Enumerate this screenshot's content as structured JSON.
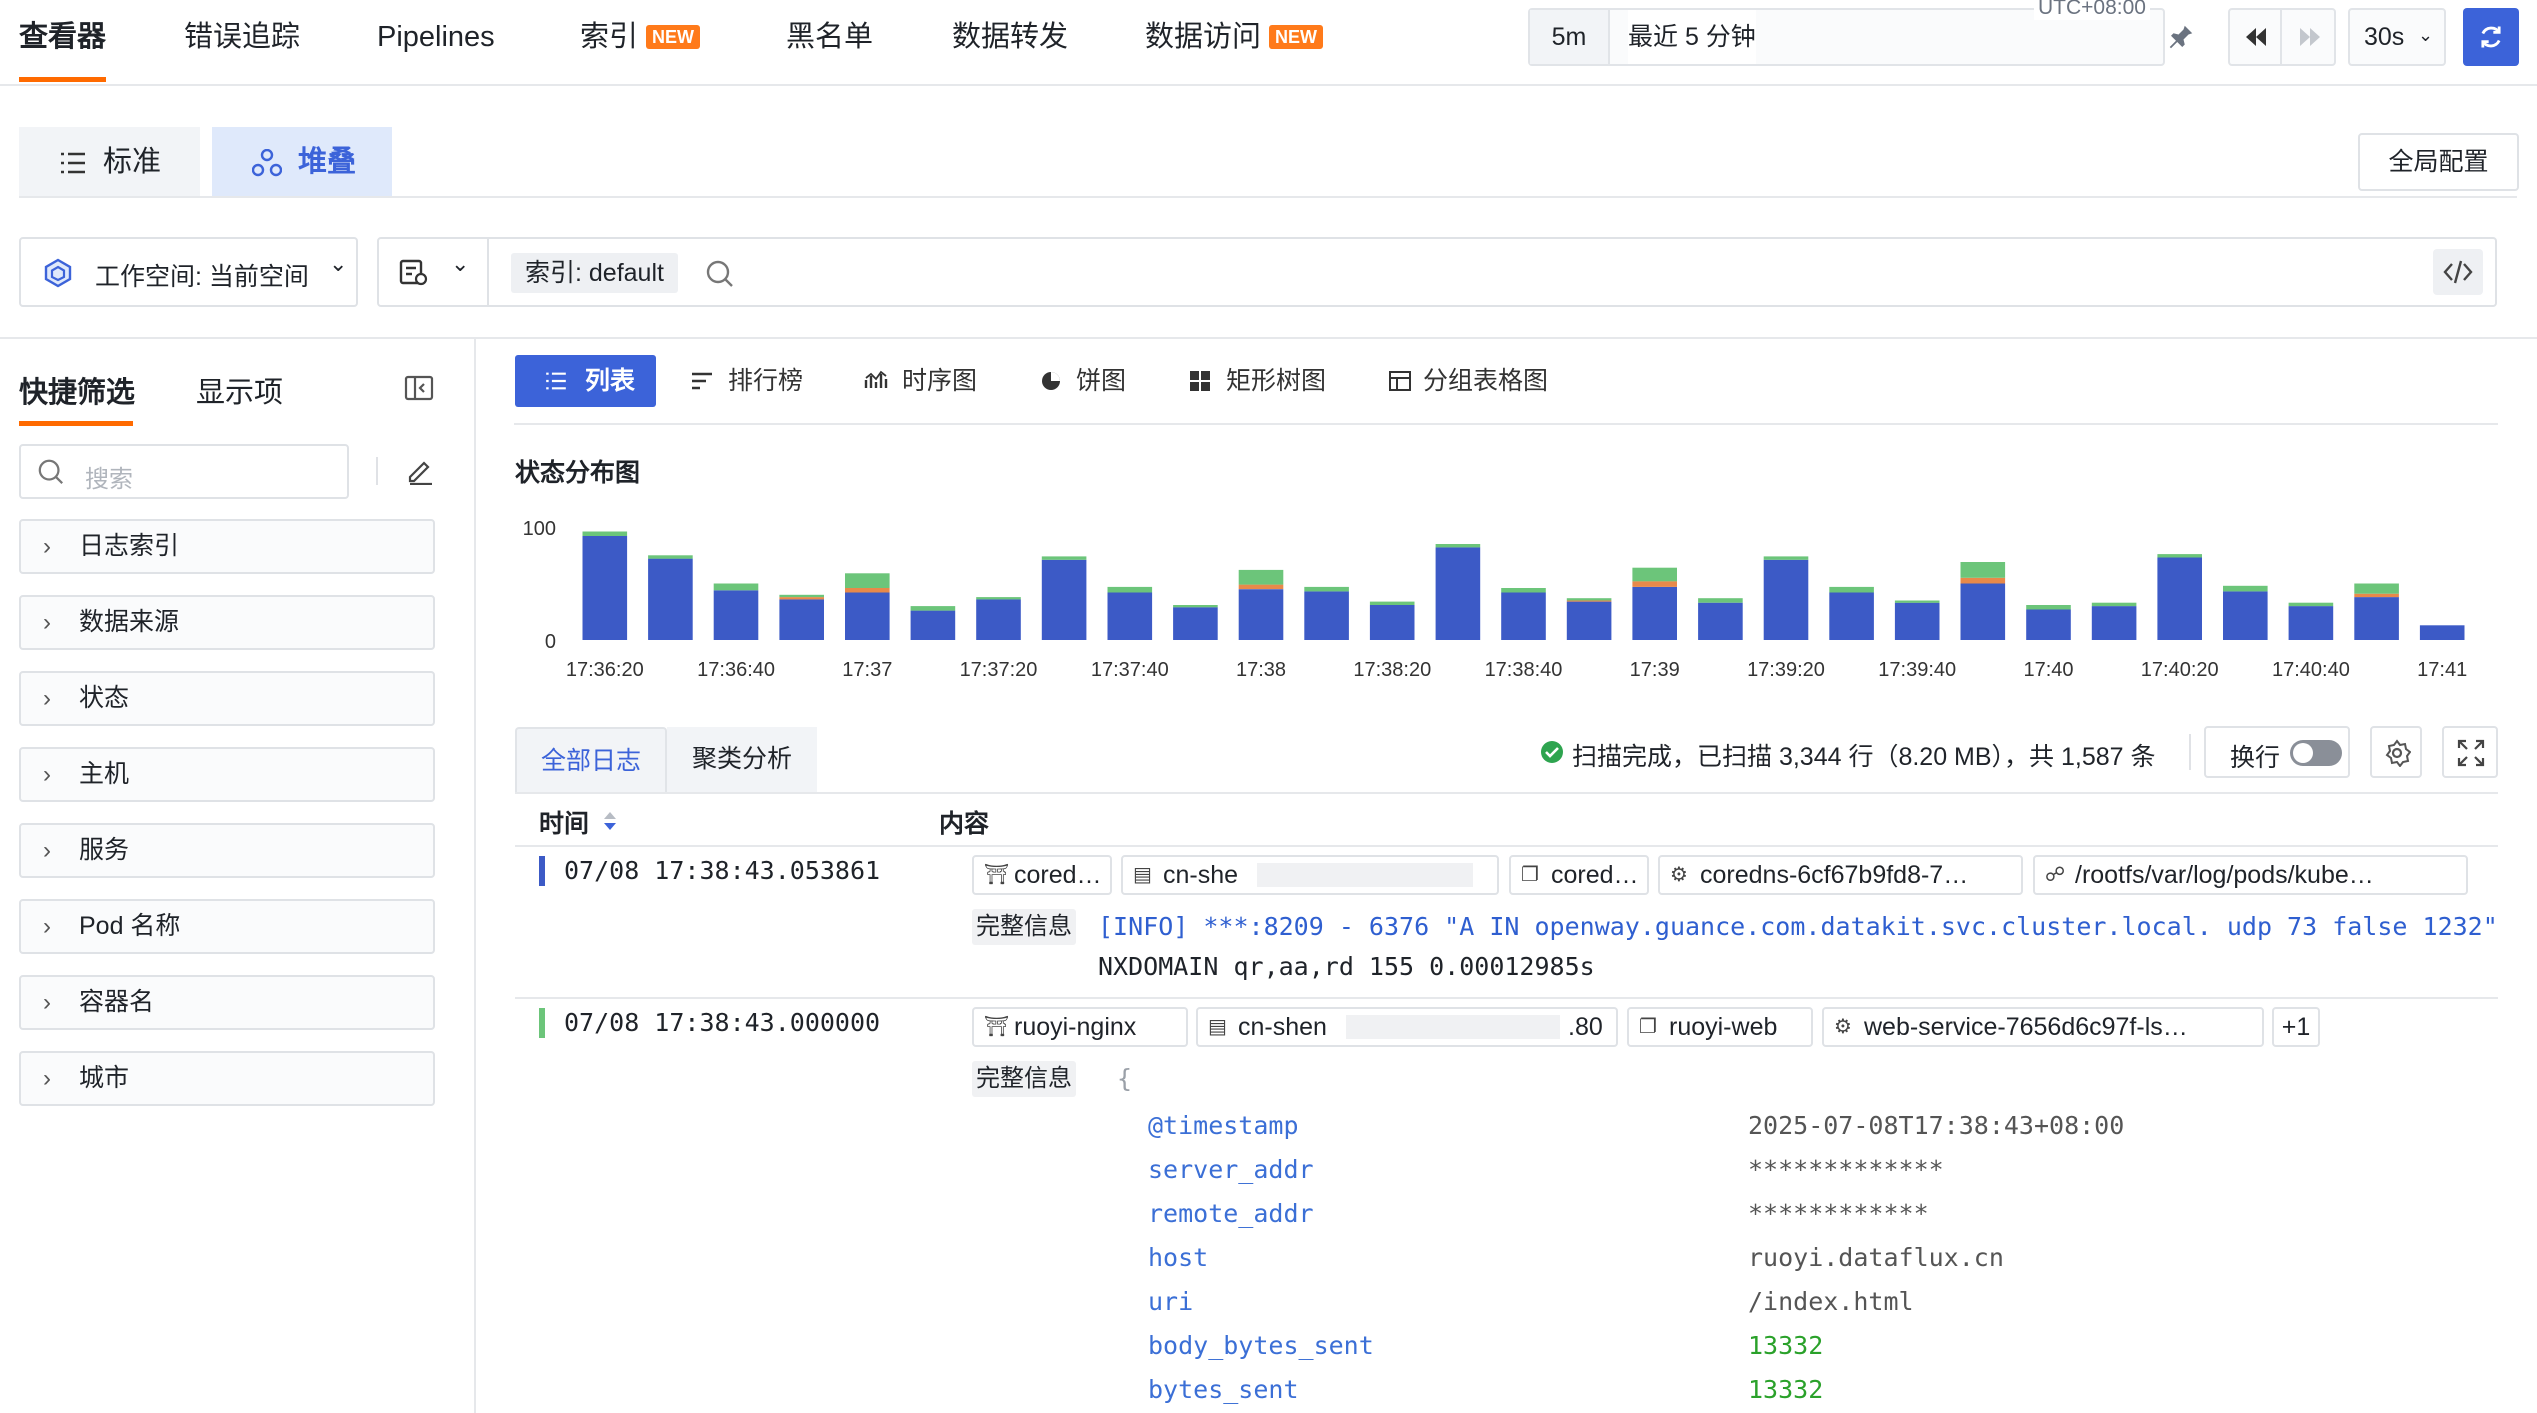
{
  "nav": {
    "tabs": [
      {
        "label": "查看器",
        "new": false
      },
      {
        "label": "错误追踪",
        "new": false
      },
      {
        "label": "Pipelines",
        "new": false
      },
      {
        "label": "索引",
        "new": true
      },
      {
        "label": "黑名单",
        "new": false
      },
      {
        "label": "数据转发",
        "new": false
      },
      {
        "label": "数据访问",
        "new": true
      }
    ],
    "new_badge": "NEW",
    "timezone": "UTC+08:00",
    "quick_range": "5m",
    "range_text": "最近 5 分钟",
    "refresh_interval": "30s"
  },
  "view": {
    "standard": "标准",
    "stacked": "堆叠",
    "global_config": "全局配置"
  },
  "query": {
    "workspace": "工作空间: 当前空间",
    "index_chip": "索引: default"
  },
  "sidebar": {
    "tab_filters": "快捷筛选",
    "tab_display": "显示项",
    "search_placeholder": "搜索",
    "facets": [
      "日志索引",
      "数据来源",
      "状态",
      "主机",
      "服务",
      "Pod 名称",
      "容器名",
      "城市"
    ]
  },
  "main": {
    "tabs": [
      "列表",
      "排行榜",
      "时序图",
      "饼图",
      "矩形树图",
      "分组表格图"
    ],
    "chart_title": "状态分布图"
  },
  "chart_data": {
    "type": "bar",
    "title": "状态分布图",
    "stacked": true,
    "ylim": [
      0,
      100
    ],
    "yticks": [
      "100",
      "0"
    ],
    "xtick_labels": [
      "17:36:20",
      "17:36:40",
      "17:37",
      "17:37:20",
      "17:37:40",
      "17:38",
      "17:38:20",
      "17:38:40",
      "17:39",
      "17:39:20",
      "17:39:40",
      "17:40",
      "17:40:20",
      "17:40:40",
      "17:41"
    ],
    "series": [
      {
        "color": "#3c5ac6",
        "values": [
          92,
          72,
          44,
          36,
          42,
          26,
          36,
          71,
          42,
          29,
          45,
          43,
          31,
          82,
          42,
          34,
          47,
          33,
          71,
          42,
          33,
          50,
          27,
          30,
          73,
          43,
          30,
          38,
          13
        ]
      },
      {
        "color": "#e8894a",
        "values": [
          0,
          0,
          0,
          2,
          4,
          0,
          0,
          0,
          0,
          0,
          4,
          0,
          0,
          0,
          0,
          1,
          5,
          0,
          0,
          0,
          0,
          5,
          0,
          0,
          0,
          0,
          0,
          3,
          0
        ]
      },
      {
        "color": "#6cc57a",
        "values": [
          4,
          3,
          6,
          2,
          13,
          4,
          2,
          3,
          5,
          2,
          13,
          4,
          3,
          3,
          4,
          2,
          12,
          4,
          3,
          5,
          2,
          14,
          4,
          3,
          3,
          5,
          3,
          9,
          0
        ]
      }
    ]
  },
  "logs": {
    "tab_all": "全部日志",
    "tab_cluster": "聚类分析",
    "scan_text": "扫描完成，已扫描 3,344 行（8.20 MB），共 1,587 条",
    "wrap_label": "换行",
    "col_time": "时间",
    "col_content": "内容",
    "full_info": "完整信息",
    "rows": [
      {
        "time": "07/08 17:38:43.053861",
        "status_color": "#3c5ac6",
        "tags": [
          "cored…",
          "cn-she",
          "cored…",
          "coredns-6cf67b9fd8-7…",
          "/rootfs/var/log/pods/kube…"
        ],
        "message_line1": "[INFO] ***:8209 - 6376 \"A IN openway.guance.com.datakit.svc.cluster.local. udp 73 false 1232\"",
        "message_line2": "NXDOMAIN qr,aa,rd 155 0.00012985s"
      },
      {
        "time": "07/08 17:38:43.000000",
        "status_color": "#6cc57a",
        "tags": [
          "ruoyi-nginx",
          "cn-shen",
          ".80",
          "ruoyi-web",
          "web-service-7656d6c97f-ls…",
          "+1"
        ],
        "brace": "{",
        "fields": [
          {
            "key": "@timestamp",
            "value": "2025-07-08T17:38:43+08:00"
          },
          {
            "key": "server_addr",
            "value": "*************"
          },
          {
            "key": "remote_addr",
            "value": "************"
          },
          {
            "key": "host",
            "value": "ruoyi.dataflux.cn"
          },
          {
            "key": "uri",
            "value": "/index.html"
          },
          {
            "key": "body_bytes_sent",
            "value": "13332"
          },
          {
            "key": "bytes_sent",
            "value": "13332"
          }
        ]
      }
    ]
  }
}
